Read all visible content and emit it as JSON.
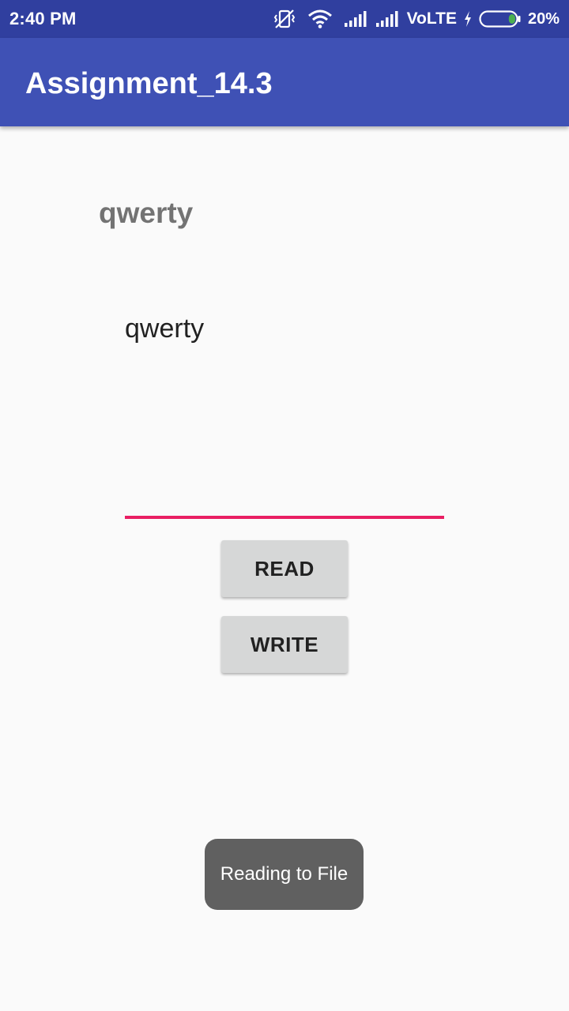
{
  "status_bar": {
    "time": "2:40 PM",
    "network_label": "VoLTE",
    "battery_percent": "20%",
    "battery_level": 0.2,
    "icons": [
      "vibrate-icon",
      "wifi-icon",
      "signal-icon",
      "signal-icon",
      "charging-icon",
      "battery-icon"
    ],
    "background_color": "#303f9f"
  },
  "app_bar": {
    "title": "Assignment_14.3",
    "background_color": "#3f51b5"
  },
  "main": {
    "label_text": "qwerty",
    "text_field_value": "qwerty",
    "text_field_underline_color": "#e91e63",
    "read_button_label": "READ",
    "write_button_label": "WRITE"
  },
  "toast": {
    "message": "Reading to File"
  }
}
